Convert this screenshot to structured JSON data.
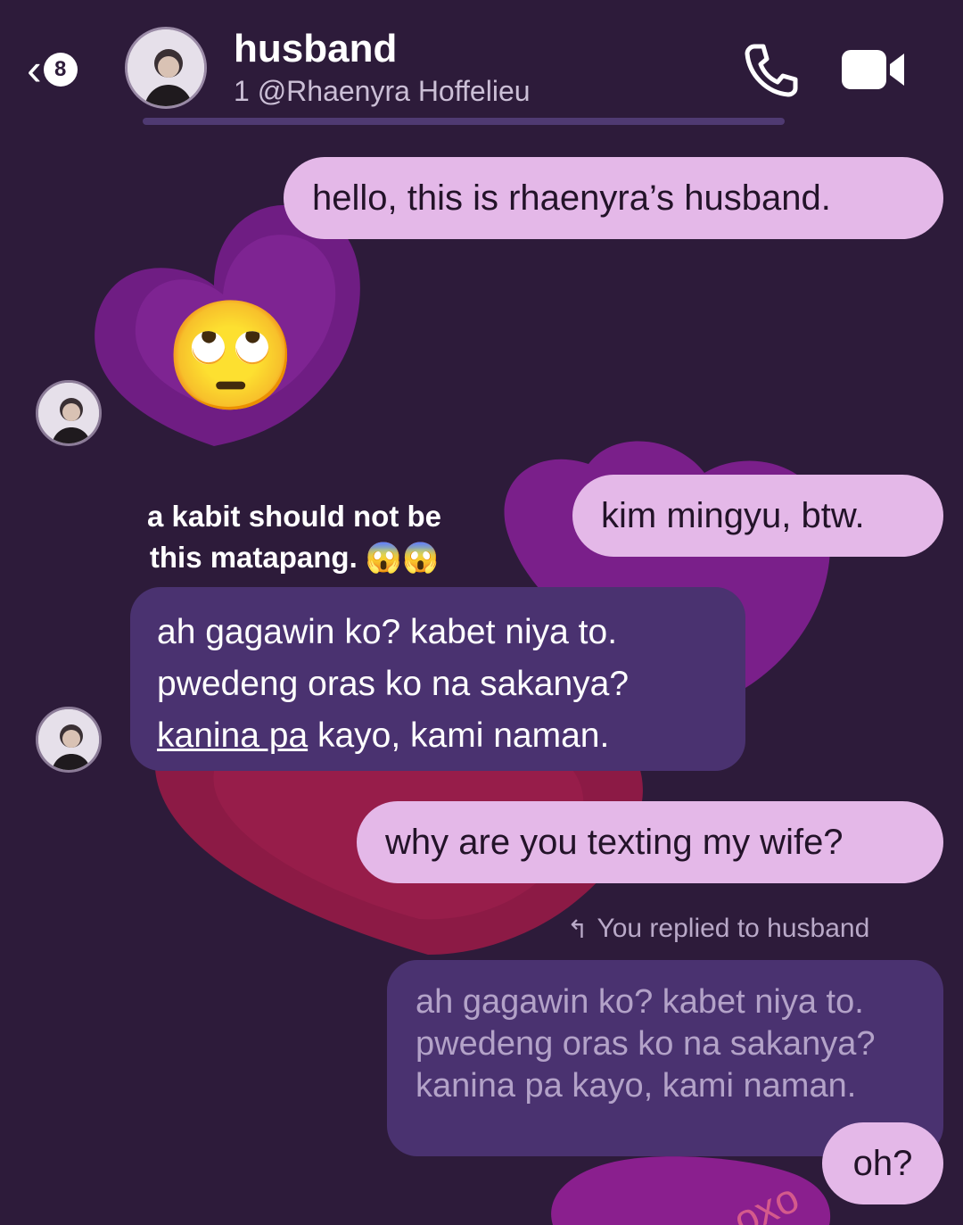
{
  "header": {
    "back_count": "8",
    "title": "husband",
    "subtitle": "1 @Rhaenyra Hoffelieu"
  },
  "messages": {
    "m1": "hello, this is rhaenyra’s husband.",
    "m2_emoji": "🙄",
    "m3_sticker_line1": "a kabit should not be",
    "m3_sticker_line2": "this matapang.",
    "m3_sticker_emoji": "😱😱",
    "m4": "kim mingyu, btw.",
    "m5_line1": "ah gagawin ko? kabet niya to.",
    "m5_line2": "pwedeng oras ko na sakanya?",
    "m5_line3_underlined": "kanina pa",
    "m5_line3_rest": " kayo, kami naman.",
    "m6": "why are you texting my wife?",
    "reply_label": "You replied to husband",
    "quoted_line1": "ah gagawin ko? kabet niya to.",
    "quoted_line2": "pwedeng oras ko na sakanya?",
    "quoted_line3": "kanina pa kayo, kami naman.",
    "m7": "oh?"
  },
  "decor": {
    "heart_text": "oxo"
  },
  "colors": {
    "background": "#2d1b3a",
    "outgoing_bubble": "#e4b8e8",
    "incoming_bubble": "#4a3270",
    "heart_purple": "#7a1f8a",
    "heart_red": "#8c1a45"
  }
}
